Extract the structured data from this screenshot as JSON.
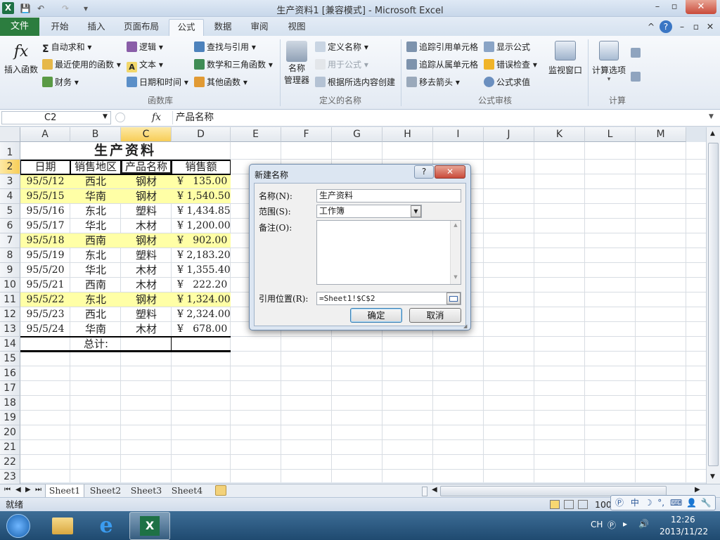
{
  "window": {
    "title": "生产资料1 [兼容模式] - Microsoft Excel",
    "app_logo": "X",
    "minimize": "–",
    "maximize": "▫",
    "close": "✕"
  },
  "quick_access": {
    "save": "💾",
    "undo": "↶",
    "redo": "↷",
    "customize": "▾"
  },
  "ribbon_tabs": {
    "file": "文件",
    "home": "开始",
    "insert": "插入",
    "layout": "页面布局",
    "formulas": "公式",
    "data": "数据",
    "review": "审阅",
    "view": "视图",
    "active": "公式"
  },
  "ribbon_right": {
    "collapse": "^",
    "help": "?",
    "min": "–",
    "restore": "▫",
    "close": "✕"
  },
  "ribbon": {
    "insert_function": {
      "label": "插入函数",
      "icon": "fx"
    },
    "function_library": {
      "label": "函数库",
      "autosum": "自动求和",
      "recent": "最近使用的函数",
      "financial": "财务",
      "logical": "逻辑",
      "text": "文本",
      "datetime": "日期和时间",
      "lookup": "查找与引用",
      "math": "数学和三角函数",
      "more": "其他函数"
    },
    "defined_names": {
      "label": "定义的名称",
      "manager_line1": "名称",
      "manager_line2": "管理器",
      "define": "定义名称",
      "use_in_formula": "用于公式",
      "create_from_sel": "根据所选内容创建"
    },
    "formula_auditing": {
      "label": "公式审核",
      "trace_precedents": "追踪引用单元格",
      "trace_dependents": "追踪从属单元格",
      "remove_arrows": "移去箭头",
      "show_formulas": "显示公式",
      "error_check": "错误检查",
      "evaluate": "公式求值",
      "watch_window": "监视窗口"
    },
    "calculation": {
      "label": "计算",
      "options": "计算选项"
    }
  },
  "formula_bar": {
    "name_box": "C2",
    "fx": "fx",
    "content": "产品名称"
  },
  "columns": [
    "A",
    "B",
    "C",
    "D",
    "E",
    "F",
    "G",
    "H",
    "I",
    "J",
    "K",
    "L",
    "M"
  ],
  "selected_column": "C",
  "selected_row": "2",
  "rows": [
    "1",
    "2",
    "3",
    "4",
    "5",
    "6",
    "7",
    "8",
    "9",
    "10",
    "11",
    "12",
    "13",
    "14",
    "15",
    "16",
    "17",
    "18",
    "19",
    "20",
    "21",
    "22",
    "23"
  ],
  "sheet": {
    "title": "生产资料",
    "headers": [
      "日期",
      "销售地区",
      "产品名称",
      "销售额"
    ],
    "data": [
      {
        "date": "95/5/12",
        "region": "西北",
        "product": "钢材",
        "amount": "¥   135.00",
        "highlight": true
      },
      {
        "date": "95/5/15",
        "region": "华南",
        "product": "钢材",
        "amount": "¥ 1,540.50",
        "highlight": true
      },
      {
        "date": "95/5/16",
        "region": "东北",
        "product": "塑料",
        "amount": "¥ 1,434.85",
        "highlight": false
      },
      {
        "date": "95/5/17",
        "region": "华北",
        "product": "木材",
        "amount": "¥ 1,200.00",
        "highlight": false
      },
      {
        "date": "95/5/18",
        "region": "西南",
        "product": "钢材",
        "amount": "¥   902.00",
        "highlight": true
      },
      {
        "date": "95/5/19",
        "region": "东北",
        "product": "塑料",
        "amount": "¥ 2,183.20",
        "highlight": false
      },
      {
        "date": "95/5/20",
        "region": "华北",
        "product": "木材",
        "amount": "¥ 1,355.40",
        "highlight": false
      },
      {
        "date": "95/5/21",
        "region": "西南",
        "product": "木材",
        "amount": "¥   222.20",
        "highlight": false
      },
      {
        "date": "95/5/22",
        "region": "东北",
        "product": "钢材",
        "amount": "¥ 1,324.00",
        "highlight": true
      },
      {
        "date": "95/5/23",
        "region": "西北",
        "product": "塑料",
        "amount": "¥ 2,324.00",
        "highlight": false
      },
      {
        "date": "95/5/24",
        "region": "华南",
        "product": "木材",
        "amount": "¥   678.00",
        "highlight": false
      }
    ],
    "total_label": "总计:",
    "highlight_color": "#ffffa6"
  },
  "sheet_tabs": [
    "Sheet1",
    "Sheet2",
    "Sheet3",
    "Sheet4"
  ],
  "active_sheet": "Sheet1",
  "status": {
    "ready": "就绪",
    "zoom": "100"
  },
  "taskbar": {
    "lang": "CH",
    "time": "12:26",
    "date": "2013/11/22"
  },
  "dialog": {
    "title": "新建名称",
    "help": "?",
    "close": "✕",
    "name_label": "名称(N):",
    "name_value": "生产资料",
    "scope_label": "范围(S):",
    "scope_value": "工作簿",
    "comment_label": "备注(O):",
    "comment_value": "",
    "refers_label": "引用位置(R):",
    "refers_value": "=Sheet1!$C$2",
    "ok": "确定",
    "cancel": "取消"
  },
  "colors": {
    "accent_green": "#2c7d3f",
    "selection": "#f7cd57",
    "close_red": "#c94a3a"
  }
}
